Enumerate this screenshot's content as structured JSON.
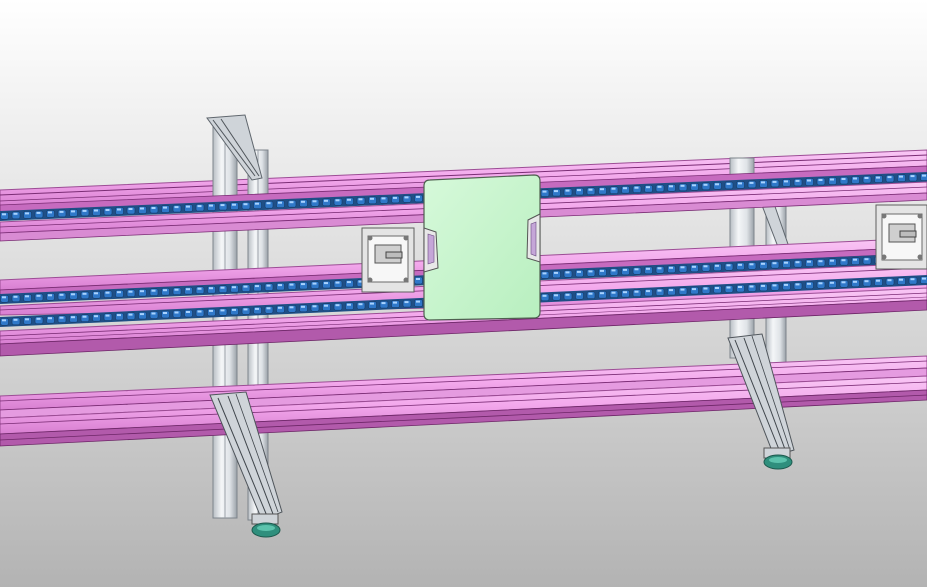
{
  "app": {
    "window_title": ""
  },
  "model": {
    "label": "",
    "components": {
      "rails": "pink-aluminum-rail",
      "rollers": "blue-roller-chain",
      "posts": "aluminum-support-post",
      "braces": "diagonal-brace",
      "feet": "caster-wheel",
      "stops": "stop-cylinder-bracket",
      "carrier": "green-pallet"
    }
  },
  "colors": {
    "background_top": "#ffffff",
    "background_bottom": "#b3b3b3",
    "rail_face": "#f6b2f0",
    "rail_edge": "#c867c0",
    "rail_dark": "#7a2c74",
    "roller": "#2f78c9",
    "roller_light": "#a9d3ff",
    "post": "#e9edf1",
    "post_edge": "#8a9097",
    "pallet": "#c9f5cf",
    "pallet_edge": "#5b6a5c",
    "wheel": "#3aa38f",
    "bracket": "#e6e6e6"
  }
}
